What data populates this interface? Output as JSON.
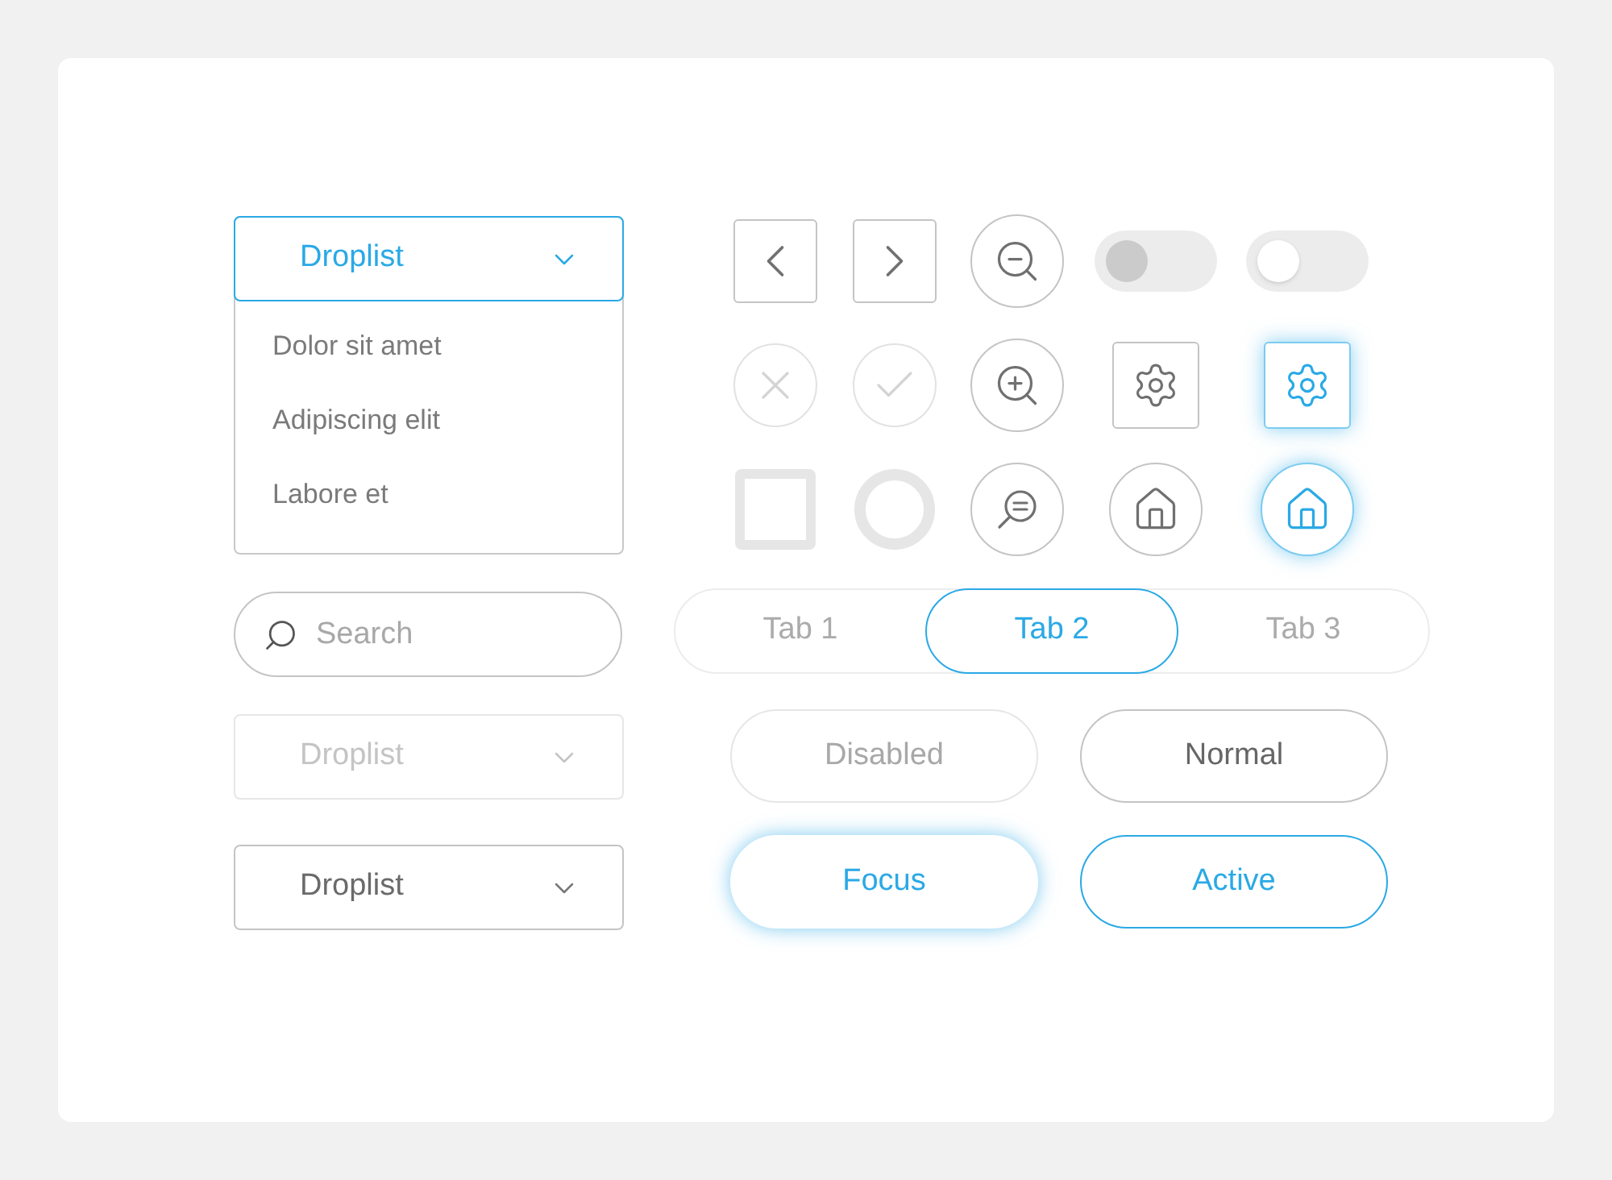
{
  "dropdown_open": {
    "label": "Droplist",
    "options": [
      "Dolor sit amet",
      "Adipiscing elit",
      "Labore et"
    ]
  },
  "search": {
    "placeholder": "Search"
  },
  "droplists": [
    {
      "label": "Droplist",
      "disabled": true
    },
    {
      "label": "Droplist",
      "disabled": false
    }
  ],
  "icon_controls": [
    {
      "kind": "prev",
      "disabled": false,
      "highlighted": false
    },
    {
      "kind": "next",
      "disabled": false,
      "highlighted": false
    },
    {
      "kind": "zoom-out",
      "disabled": false,
      "highlighted": false
    },
    {
      "kind": "toggle",
      "on": false,
      "disabled": true
    },
    {
      "kind": "toggle",
      "on": false,
      "disabled": false
    },
    {
      "kind": "close",
      "disabled": true
    },
    {
      "kind": "check",
      "disabled": true
    },
    {
      "kind": "zoom-in",
      "disabled": false,
      "highlighted": false
    },
    {
      "kind": "settings",
      "disabled": false,
      "highlighted": false
    },
    {
      "kind": "settings",
      "disabled": false,
      "highlighted": true
    },
    {
      "kind": "checkbox",
      "checked": false
    },
    {
      "kind": "radio",
      "checked": false
    },
    {
      "kind": "chat-search",
      "disabled": false,
      "highlighted": false
    },
    {
      "kind": "home",
      "disabled": false,
      "highlighted": false
    },
    {
      "kind": "home",
      "disabled": false,
      "highlighted": true
    }
  ],
  "tabs": [
    {
      "label": "Tab 1",
      "selected": false
    },
    {
      "label": "Tab 2",
      "selected": true
    },
    {
      "label": "Tab 3",
      "selected": false
    }
  ],
  "buttons": [
    {
      "label": "Disabled",
      "disabled": true,
      "focused": false,
      "active": false
    },
    {
      "label": "Normal",
      "disabled": false,
      "focused": false,
      "active": false
    },
    {
      "label": "Focus",
      "disabled": false,
      "focused": true,
      "active": false
    },
    {
      "label": "Active",
      "disabled": false,
      "focused": false,
      "active": true
    }
  ]
}
